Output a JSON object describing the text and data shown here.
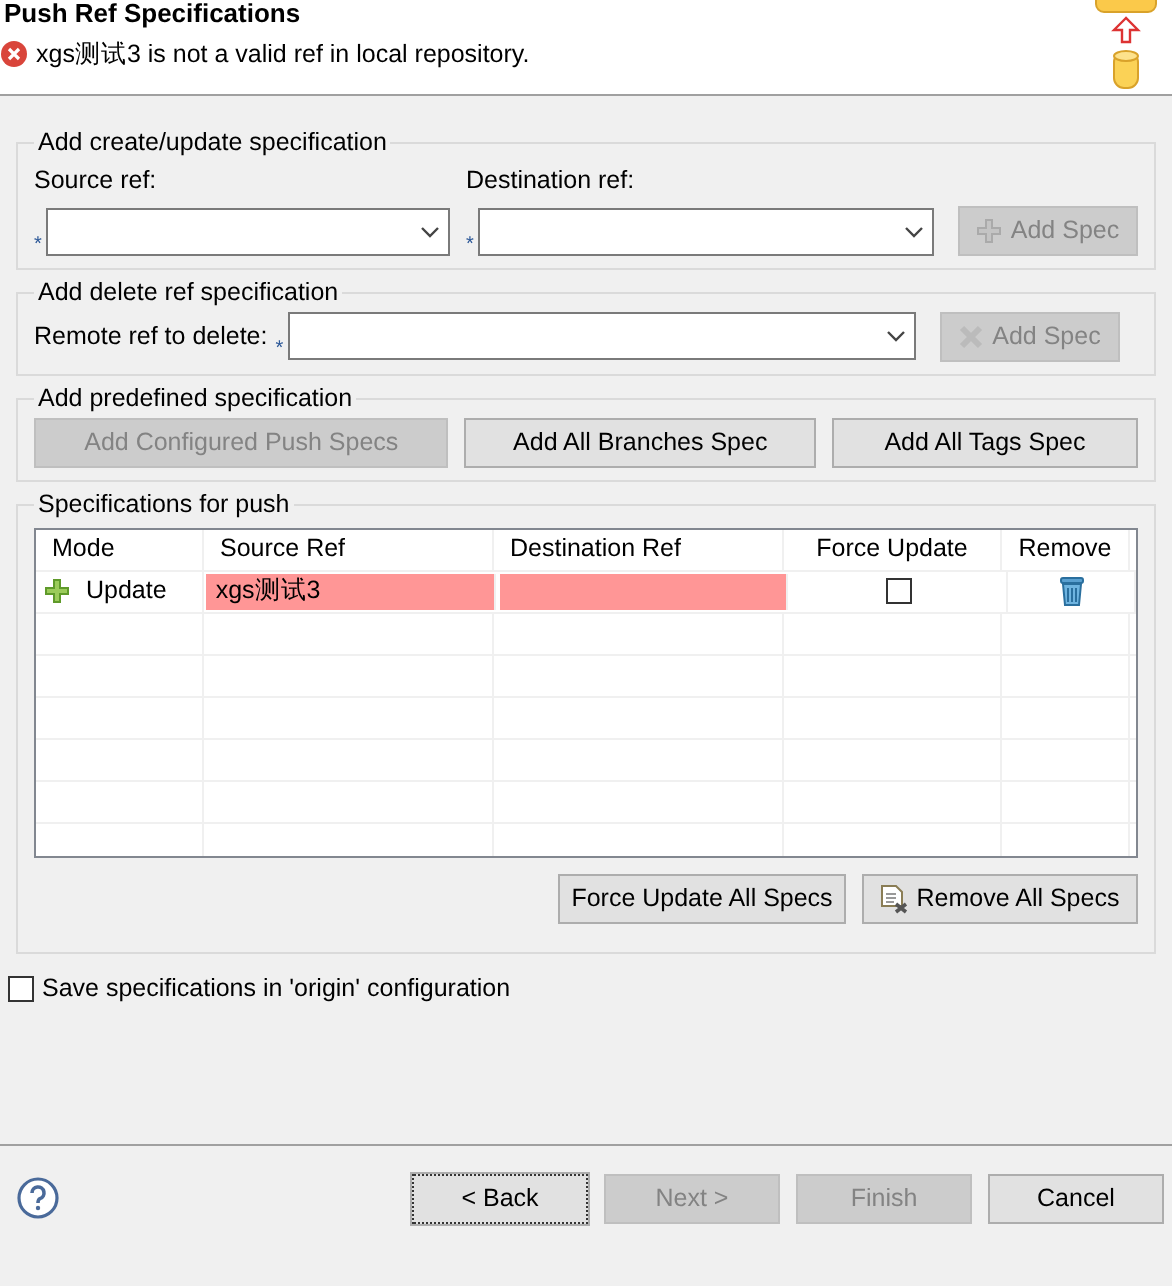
{
  "title": "Push Ref Specifications",
  "message": {
    "kind": "error",
    "text": "xgs测试3 is not a valid ref in local repository."
  },
  "create_update": {
    "legend": "Add create/update specification",
    "source_label": "Source ref:",
    "destination_label": "Destination ref:",
    "required_mark": "*",
    "button": {
      "label": "Add Spec",
      "disabled": true
    }
  },
  "delete": {
    "legend": "Add delete ref specification",
    "label": "Remote ref to delete:",
    "required_mark": "*",
    "button": {
      "label": "Add Spec",
      "disabled": true
    }
  },
  "predefined": {
    "legend": "Add predefined specification",
    "buttons": [
      {
        "label": "Add Configured Push Specs",
        "disabled": true
      },
      {
        "label": "Add All Branches Spec",
        "disabled": false
      },
      {
        "label": "Add All Tags Spec",
        "disabled": false
      }
    ]
  },
  "specs": {
    "legend": "Specifications for push",
    "columns": [
      "Mode",
      "Source Ref",
      "Destination Ref",
      "Force Update",
      "Remove"
    ],
    "rows": [
      {
        "mode": "Update",
        "source_ref": "xgs测试3",
        "invalid": true,
        "force_update": false
      }
    ],
    "buttons": [
      {
        "label": "Force Update All Specs"
      },
      {
        "label": "Remove All Specs"
      }
    ]
  },
  "save_option": {
    "label": "Save specifications in 'origin' configuration",
    "checked": false
  },
  "footer_buttons": [
    {
      "label": "< Back",
      "disabled": false,
      "focused": true
    },
    {
      "label": "Next >",
      "disabled": true,
      "focused": false
    },
    {
      "label": "Finish",
      "disabled": true,
      "focused": false
    },
    {
      "label": "Cancel",
      "disabled": false,
      "focused": false
    }
  ]
}
